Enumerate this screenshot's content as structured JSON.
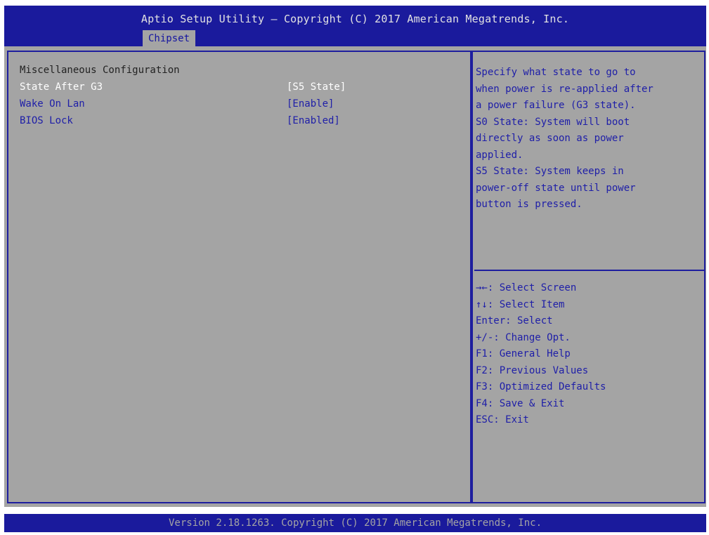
{
  "header": {
    "title": "Aptio Setup Utility – Copyright (C) 2017 American Megatrends, Inc.",
    "tab": "Chipset"
  },
  "main": {
    "section_title": "Miscellaneous Configuration",
    "settings": [
      {
        "label": "State After G3",
        "value": "[S5 State]",
        "selected": true
      },
      {
        "label": "Wake On Lan",
        "value": "[Enable]",
        "selected": false
      },
      {
        "label": "BIOS Lock",
        "value": "[Enabled]",
        "selected": false
      }
    ]
  },
  "help": {
    "lines": [
      "Specify what state to go to",
      "when power is re-applied after",
      "a power failure (G3 state).",
      "S0 State: System will boot",
      "directly as soon as power",
      "applied.",
      "S5 State: System keeps in",
      "power-off state until power",
      "button is pressed."
    ]
  },
  "keys": [
    "→←: Select Screen",
    "↑↓: Select Item",
    "Enter: Select",
    "+/-: Change Opt.",
    "F1: General Help",
    "F2: Previous Values",
    "F3: Optimized Defaults",
    "F4: Save & Exit",
    "ESC: Exit"
  ],
  "footer": {
    "text": "Version 2.18.1263. Copyright (C) 2017 American Megatrends, Inc."
  },
  "colors": {
    "header_bg": "#1a1a9c",
    "panel_bg": "#a4a4a4",
    "item_text": "#1e1ea8",
    "selected_text": "#ffffff"
  }
}
